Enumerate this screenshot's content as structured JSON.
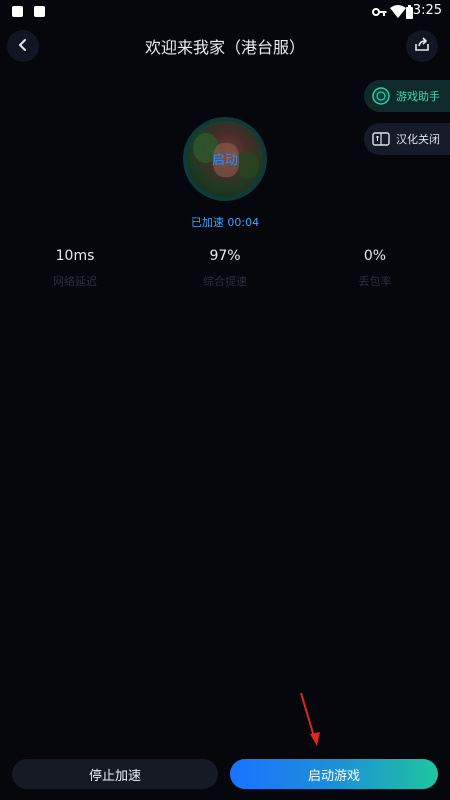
{
  "status_bar": {
    "time": "3:25"
  },
  "header": {
    "title": "欢迎来我家（港台服）"
  },
  "side_buttons": {
    "assistant_label": "游戏助手",
    "translate_label": "汉化关闭"
  },
  "game": {
    "icon_label": "启动",
    "accel_status": "已加速 00:04"
  },
  "stats": [
    {
      "value": "10ms",
      "label": "网络延迟"
    },
    {
      "value": "97%",
      "label": "综合提速"
    },
    {
      "value": "0%",
      "label": "丢包率"
    }
  ],
  "actions": {
    "stop_label": "停止加速",
    "launch_label": "启动游戏"
  },
  "colors": {
    "background": "#05070c",
    "accent_blue": "#1a73ff",
    "accent_green": "#1fc5a0",
    "annotation_arrow": "#e0261f"
  }
}
